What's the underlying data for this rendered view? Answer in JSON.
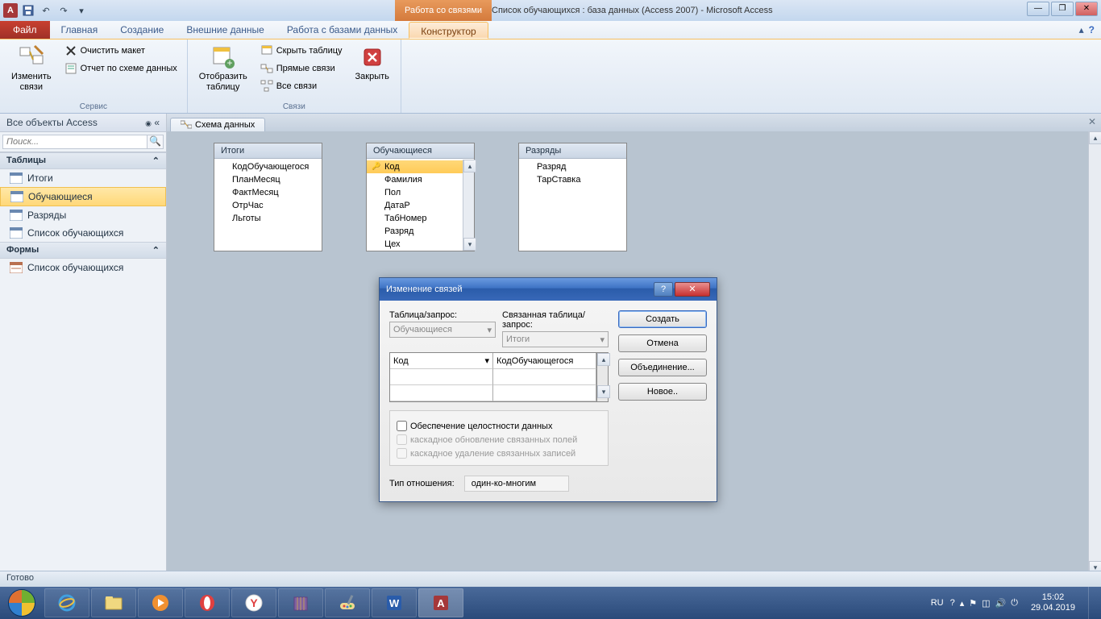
{
  "window": {
    "contextual_group": "Работа со связями",
    "title": "Список обучающихся : база данных (Access 2007)  -  Microsoft Access"
  },
  "ribbon": {
    "file": "Файл",
    "tabs": [
      "Главная",
      "Создание",
      "Внешние данные",
      "Работа с базами данных",
      "Конструктор"
    ],
    "groups": {
      "service": {
        "label": "Сервис",
        "edit_relations": "Изменить\nсвязи",
        "clear_layout": "Очистить макет",
        "relations_report": "Отчет по схеме данных"
      },
      "relations": {
        "label": "Связи",
        "show_table": "Отобразить\nтаблицу",
        "hide_table": "Скрыть таблицу",
        "direct_relations": "Прямые связи",
        "all_relations": "Все связи",
        "close": "Закрыть"
      }
    }
  },
  "nav": {
    "header": "Все объекты Access",
    "search_placeholder": "Поиск...",
    "groups": {
      "tables": {
        "label": "Таблицы",
        "items": [
          "Итоги",
          "Обучающиеся",
          "Разряды",
          "Список обучающихся"
        ]
      },
      "forms": {
        "label": "Формы",
        "items": [
          "Список обучающихся"
        ]
      }
    },
    "selected": "Обучающиеся"
  },
  "doc_tab": "Схема данных",
  "tables": {
    "itogi": {
      "title": "Итоги",
      "fields": [
        "КодОбучающегося",
        "ПланМесяц",
        "ФактМесяц",
        "ОтрЧас",
        "Льготы"
      ]
    },
    "obuch": {
      "title": "Обучающиеся",
      "fields": [
        "Код",
        "Фамилия",
        "Пол",
        "ДатаР",
        "ТабНомер",
        "Разряд",
        "Цех"
      ],
      "pk": "Код"
    },
    "razr": {
      "title": "Разряды",
      "fields": [
        "Разряд",
        "ТарСтавка"
      ]
    }
  },
  "dialog": {
    "title": "Изменение связей",
    "table_query": "Таблица/запрос:",
    "related_table": "Связанная таблица/запрос:",
    "left_table": "Обучающиеся",
    "right_table": "Итоги",
    "left_field": "Код",
    "right_field": "КодОбучающегося",
    "integrity": "Обеспечение целостности данных",
    "cascade_update": "каскадное обновление связанных полей",
    "cascade_delete": "каскадное удаление связанных записей",
    "rel_type_label": "Тип отношения:",
    "rel_type": "один-ко-многим",
    "btn_create": "Создать",
    "btn_cancel": "Отмена",
    "btn_join": "Объединение...",
    "btn_new": "Новое.."
  },
  "status": "Готово",
  "tray": {
    "lang": "RU",
    "time": "15:02",
    "date": "29.04.2019"
  }
}
